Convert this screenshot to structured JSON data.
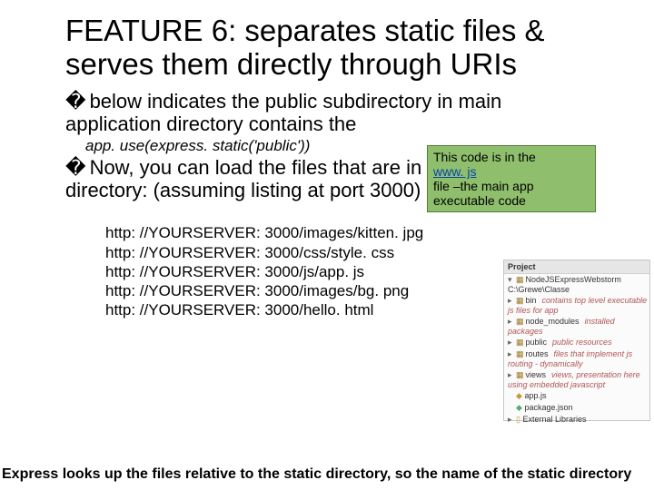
{
  "title": "FEATURE 6: separates static files & serves them directly through URIs",
  "bullet1": "below indicates the public subdirectory in main application directory contains the",
  "code_line": "app. use(express. static('public'))",
  "callout": {
    "l1": "This code is in the",
    "link": "www. js",
    "l2": "file –the main app executable code"
  },
  "bullet2": "Now, you can load the files that are in the public directory: (assuming listing at port 3000)",
  "urls": [
    "http: //YOURSERVER: 3000/images/kitten. jpg",
    "http: //YOURSERVER: 3000/css/style. css",
    "http: //YOURSERVER: 3000/js/app. js",
    "http: //YOURSERVER: 3000/images/bg. png",
    "http: //YOURSERVER: 3000/hello. html"
  ],
  "project": {
    "hdr": "Project",
    "root": "NodeJSExpressWebstorm  C:\\Grewe\\Classe",
    "items": [
      {
        "name": "bin",
        "ann": "contains top level executable js files for app"
      },
      {
        "name": "node_modules",
        "ann": "installed packages"
      },
      {
        "name": "public",
        "ann": "public resources"
      },
      {
        "name": "routes",
        "ann": "files that implement js routing - dynamically"
      },
      {
        "name": "views",
        "ann": "views, presentation here using embedded javascript"
      },
      {
        "name": "app.js",
        "ann": "",
        "icon": "js"
      },
      {
        "name": "package.json",
        "ann": "",
        "icon": "json"
      }
    ],
    "ext": "External Libraries"
  },
  "footer": "Express looks up the files relative to the static directory, so the name of the static directory"
}
